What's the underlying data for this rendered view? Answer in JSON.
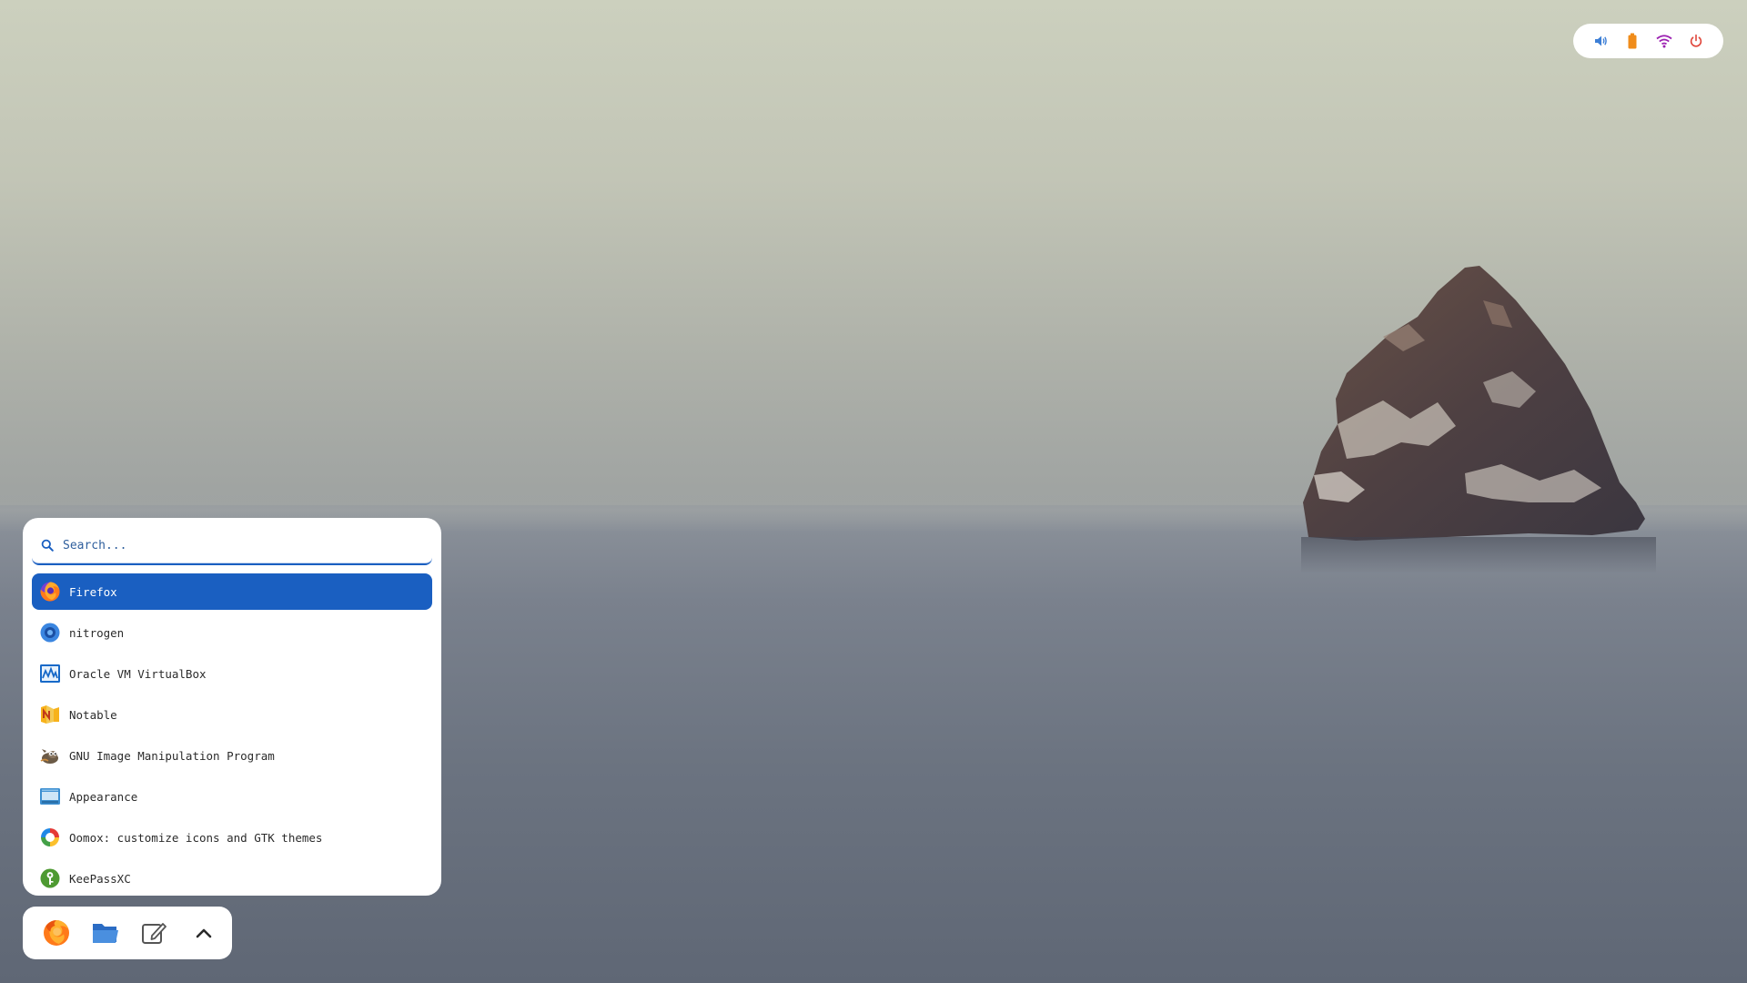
{
  "tray": {
    "icons": [
      "volume-icon",
      "battery-icon",
      "wifi-icon",
      "power-icon"
    ],
    "colors": {
      "volume": "#3d7fd6",
      "battery": "#f08c1a",
      "wifi": "#9b1fb0",
      "power": "#e0453a"
    }
  },
  "launcher": {
    "search": {
      "placeholder": "Search...",
      "value": ""
    },
    "items": [
      {
        "label": "Firefox",
        "icon": "firefox-icon",
        "selected": true
      },
      {
        "label": "nitrogen",
        "icon": "nitrogen-icon",
        "selected": false
      },
      {
        "label": "Oracle VM VirtualBox",
        "icon": "virtualbox-icon",
        "selected": false
      },
      {
        "label": "Notable",
        "icon": "notable-icon",
        "selected": false
      },
      {
        "label": "GNU Image Manipulation Program",
        "icon": "gimp-icon",
        "selected": false
      },
      {
        "label": "Appearance",
        "icon": "appearance-icon",
        "selected": false
      },
      {
        "label": "Oomox: customize icons and GTK themes",
        "icon": "oomox-icon",
        "selected": false
      },
      {
        "label": "KeePassXC",
        "icon": "keepassxc-icon",
        "selected": false
      }
    ],
    "accent": "#1a5fc1"
  },
  "dock": {
    "items": [
      "firefox-icon",
      "folder-icon",
      "text-editor-icon",
      "chevron-up-icon"
    ]
  }
}
